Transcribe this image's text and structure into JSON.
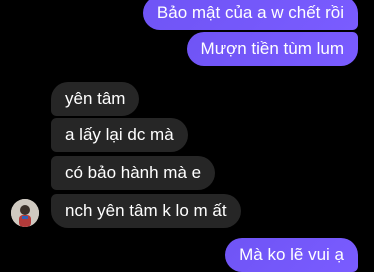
{
  "colors": {
    "outgoing_start": "#6f54f5",
    "outgoing_end": "#7a5cff",
    "incoming_bg": "#262626",
    "background": "#000000"
  },
  "messages": [
    {
      "id": "out0",
      "direction": "outgoing",
      "text": "Bảo mật của a w chết rồi"
    },
    {
      "id": "out1",
      "direction": "outgoing",
      "text": "Mượn tiền tùm lum"
    },
    {
      "id": "in0",
      "direction": "incoming",
      "text": "yên tâm"
    },
    {
      "id": "in1",
      "direction": "incoming",
      "text": "a lấy lại dc mà"
    },
    {
      "id": "in2",
      "direction": "incoming",
      "text": "có bảo hành mà e"
    },
    {
      "id": "in3",
      "direction": "incoming",
      "text": "nch yên tâm k lo m ất"
    },
    {
      "id": "out2",
      "direction": "outgoing",
      "text": "Mà ko lẽ vui ạ"
    }
  ],
  "avatar": {
    "icon": "user-avatar-icon"
  }
}
